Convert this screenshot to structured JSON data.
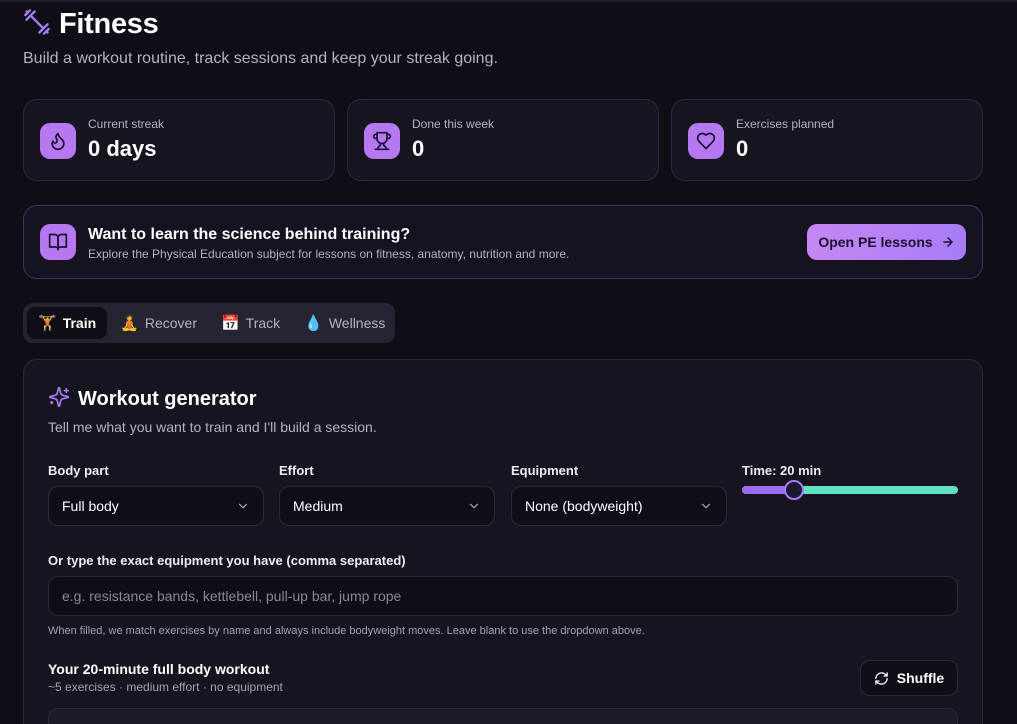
{
  "header": {
    "title": "Fitness",
    "subtitle": "Build a workout routine, track sessions and keep your streak going.",
    "icon": "dumbbell-icon"
  },
  "stats": [
    {
      "label": "Current streak",
      "value": "0 days",
      "icon": "flame-icon"
    },
    {
      "label": "Done this week",
      "value": "0",
      "icon": "trophy-icon"
    },
    {
      "label": "Exercises planned",
      "value": "0",
      "icon": "heart-icon"
    }
  ],
  "banner": {
    "title": "Want to learn the science behind training?",
    "description": "Explore the Physical Education subject for lessons on fitness, anatomy, nutrition and more.",
    "button_label": "Open PE lessons",
    "icon": "book-open-icon"
  },
  "tabs": [
    {
      "emoji": "🏋",
      "label": "Train",
      "active": true
    },
    {
      "emoji": "🧘",
      "label": "Recover",
      "active": false
    },
    {
      "emoji": "📅",
      "label": "Track",
      "active": false
    },
    {
      "emoji": "💧",
      "label": "Wellness",
      "active": false
    }
  ],
  "generator": {
    "title": "Workout generator",
    "description": "Tell me what you want to train and I'll build a session.",
    "body_part": {
      "label": "Body part",
      "value": "Full body"
    },
    "effort": {
      "label": "Effort",
      "value": "Medium"
    },
    "equipment": {
      "label": "Equipment",
      "value": "None (bodyweight)"
    },
    "time": {
      "label": "Time: 20 min",
      "fraction": 0.24
    },
    "custom_equipment": {
      "label": "Or type the exact equipment you have (comma separated)",
      "placeholder": "e.g. resistance bands, kettlebell, pull-up bar, jump rope",
      "value": "",
      "hint": "When filled, we match exercises by name and always include bodyweight moves. Leave blank to use the dropdown above."
    },
    "workout": {
      "title": "Your 20-minute full body workout",
      "meta": "~5 exercises · medium effort · no equipment",
      "shuffle_label": "Shuffle"
    }
  },
  "colors": {
    "accent": "#b678f0",
    "slider_fill": "#9b6cf0",
    "slider_rest": "#5fe0c0",
    "background": "#0f0e17",
    "card": "#16151f"
  }
}
